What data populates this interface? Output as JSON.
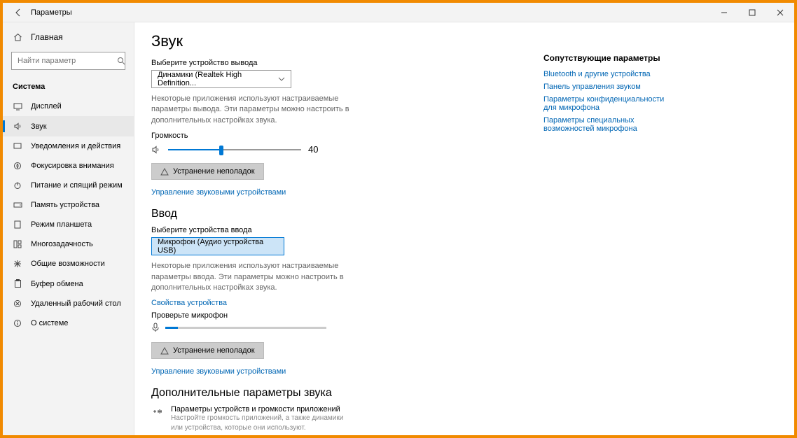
{
  "titlebar": {
    "title": "Параметры"
  },
  "sidebar": {
    "home": "Главная",
    "search_placeholder": "Найти параметр",
    "group": "Система",
    "items": [
      {
        "label": "Дисплей"
      },
      {
        "label": "Звук",
        "active": true
      },
      {
        "label": "Уведомления и действия"
      },
      {
        "label": "Фокусировка внимания"
      },
      {
        "label": "Питание и спящий режим"
      },
      {
        "label": "Память устройства"
      },
      {
        "label": "Режим планшета"
      },
      {
        "label": "Многозадачность"
      },
      {
        "label": "Общие возможности"
      },
      {
        "label": "Буфер обмена"
      },
      {
        "label": "Удаленный рабочий стол"
      },
      {
        "label": "О системе"
      }
    ]
  },
  "page": {
    "title": "Звук",
    "output": {
      "choose_label": "Выберите устройство вывода",
      "device": "Динамики (Realtek High Definition...",
      "desc": "Некоторые приложения используют настраиваемые параметры вывода. Эти параметры можно настроить в дополнительных настройках звука.",
      "volume_label": "Громкость",
      "volume": 40,
      "troubleshoot": "Устранение неполадок",
      "manage": "Управление звуковыми устройствами"
    },
    "input": {
      "heading": "Ввод",
      "choose_label": "Выберите устройства ввода",
      "device": "Микрофон (Аудио устройства USB)",
      "desc": "Некоторые приложения используют настраиваемые параметры ввода. Эти параметры можно настроить в дополнительных настройках звука.",
      "device_props": "Свойства устройства",
      "test_label": "Проверьте микрофон",
      "troubleshoot": "Устранение неполадок",
      "manage": "Управление звуковыми устройствами"
    },
    "advanced": {
      "heading": "Дополнительные параметры звука",
      "app_title": "Параметры устройств и громкости приложений",
      "app_desc": "Настройте громкость приложений, а также динамики или устройства, которые они используют."
    }
  },
  "related": {
    "heading": "Сопутствующие параметры",
    "links": [
      "Bluetooth и другие устройства",
      "Панель управления звуком",
      "Параметры конфиденциальности для микрофона",
      "Параметры специальных возможностей микрофона"
    ]
  }
}
